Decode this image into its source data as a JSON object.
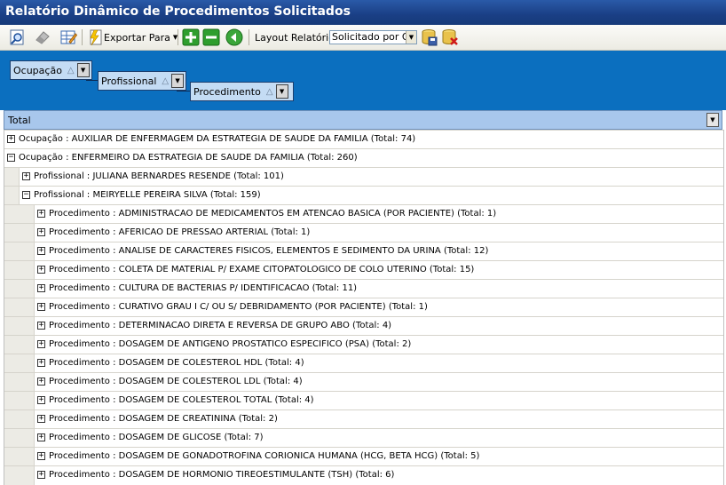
{
  "window": {
    "title": "Relatório Dinâmico de Procedimentos Solicitados"
  },
  "toolbar": {
    "export_label": "Exportar Para",
    "layout_label": "Layout Relatório",
    "layout_value": "Solicitado por Ocu"
  },
  "group_panel": {
    "fields": [
      "Ocupação",
      "Profissional",
      "Procedimento"
    ]
  },
  "grid": {
    "header": "Total",
    "rows": [
      {
        "level": 0,
        "expanded": false,
        "text": "Ocupação : AUXILIAR DE ENFERMAGEM DA ESTRATEGIA DE SAUDE DA FAMILIA (Total: 74)"
      },
      {
        "level": 0,
        "expanded": true,
        "text": "Ocupação : ENFERMEIRO DA ESTRATEGIA DE SAUDE DA FAMILIA (Total: 260)"
      },
      {
        "level": 1,
        "expanded": false,
        "text": "Profissional : JULIANA BERNARDES RESENDE (Total: 101)"
      },
      {
        "level": 1,
        "expanded": true,
        "text": "Profissional : MEIRYELLE PEREIRA SILVA (Total: 159)"
      },
      {
        "level": 2,
        "expanded": false,
        "text": "Procedimento : ADMINISTRACAO DE MEDICAMENTOS EM ATENCAO BASICA (POR PACIENTE) (Total: 1)"
      },
      {
        "level": 2,
        "expanded": false,
        "text": "Procedimento : AFERICAO DE PRESSAO ARTERIAL (Total: 1)"
      },
      {
        "level": 2,
        "expanded": false,
        "text": "Procedimento : ANALISE DE CARACTERES FISICOS, ELEMENTOS E SEDIMENTO DA URINA (Total: 12)"
      },
      {
        "level": 2,
        "expanded": false,
        "text": "Procedimento : COLETA DE MATERIAL P/ EXAME CITOPATOLOGICO DE COLO UTERINO (Total: 15)"
      },
      {
        "level": 2,
        "expanded": false,
        "text": "Procedimento : CULTURA DE BACTERIAS P/ IDENTIFICACAO (Total: 11)"
      },
      {
        "level": 2,
        "expanded": false,
        "text": "Procedimento : CURATIVO GRAU I C/ OU S/ DEBRIDAMENTO (POR PACIENTE) (Total: 1)"
      },
      {
        "level": 2,
        "expanded": false,
        "text": "Procedimento : DETERMINACAO DIRETA E REVERSA DE GRUPO ABO (Total: 4)"
      },
      {
        "level": 2,
        "expanded": false,
        "text": "Procedimento : DOSAGEM DE ANTIGENO PROSTATICO ESPECIFICO (PSA) (Total: 2)"
      },
      {
        "level": 2,
        "expanded": false,
        "text": "Procedimento : DOSAGEM DE COLESTEROL HDL (Total: 4)"
      },
      {
        "level": 2,
        "expanded": false,
        "text": "Procedimento : DOSAGEM DE COLESTEROL LDL (Total: 4)"
      },
      {
        "level": 2,
        "expanded": false,
        "text": "Procedimento : DOSAGEM DE COLESTEROL TOTAL (Total: 4)"
      },
      {
        "level": 2,
        "expanded": false,
        "text": "Procedimento : DOSAGEM DE CREATININA (Total: 2)"
      },
      {
        "level": 2,
        "expanded": false,
        "text": "Procedimento : DOSAGEM DE GLICOSE (Total: 7)"
      },
      {
        "level": 2,
        "expanded": false,
        "text": "Procedimento : DOSAGEM DE GONADOTROFINA CORIONICA HUMANA (HCG, BETA HCG) (Total: 5)"
      },
      {
        "level": 2,
        "expanded": false,
        "text": "Procedimento : DOSAGEM DE HORMONIO TIREOESTIMULANTE (TSH) (Total: 6)"
      }
    ]
  },
  "colors": {
    "titlebar": "#1a3f85",
    "group_panel": "#0b6fbf",
    "header": "#a8c7ec"
  }
}
